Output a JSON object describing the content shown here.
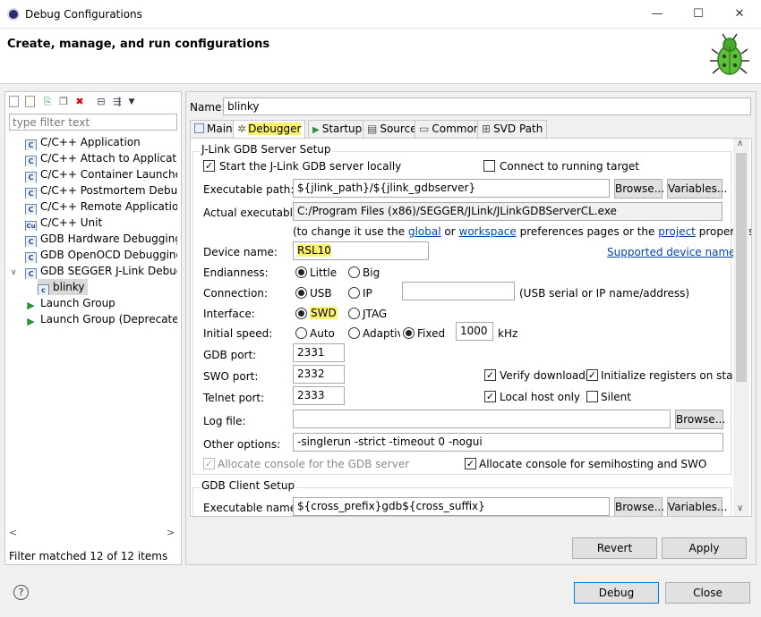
{
  "window": {
    "title": "Debug Configurations",
    "minimize": "—",
    "maximize": "☐",
    "close": "✕"
  },
  "banner": {
    "title": "Create, manage, and run configurations"
  },
  "left": {
    "filter_placeholder": "type filter text",
    "tree": [
      {
        "label": "C/C++ Application",
        "icon": "C"
      },
      {
        "label": "C/C++ Attach to Application",
        "icon": "C"
      },
      {
        "label": "C/C++ Container Launcher",
        "icon": "C"
      },
      {
        "label": "C/C++ Postmortem Debugge",
        "icon": "C"
      },
      {
        "label": "C/C++ Remote Application",
        "icon": "C"
      },
      {
        "label": "C/C++ Unit",
        "icon": "Cu"
      },
      {
        "label": "GDB Hardware Debugging",
        "icon": "C"
      },
      {
        "label": "GDB OpenOCD Debugging",
        "icon": "C"
      },
      {
        "label": "GDB SEGGER J-Link Debuggir",
        "icon": "C"
      },
      {
        "label": "blinky",
        "icon": "c"
      },
      {
        "label": "Launch Group",
        "icon": "play"
      },
      {
        "label": "Launch Group (Deprecated)",
        "icon": "play"
      }
    ],
    "expand_arrow": "∨",
    "scroll_left": "<",
    "scroll_right": ">",
    "status": "Filter matched 12 of 12 items"
  },
  "right": {
    "name_label": "Name:",
    "name_value": "blinky",
    "tabs": [
      "Main",
      "Debugger",
      "Startup",
      "Source",
      "Common",
      "SVD Path"
    ],
    "server": {
      "group_title": "J-Link GDB Server Setup",
      "start_locally": "Start the J-Link GDB server locally",
      "connect_running": "Connect to running target",
      "exe_path_label": "Executable path:",
      "exe_path_value": "${jlink_path}/${jlink_gdbserver}",
      "browse": "Browse...",
      "variables": "Variables...",
      "actual_exe_label": "Actual executable:",
      "actual_exe_value": "C:/Program Files (x86)/SEGGER/JLink/JLinkGDBServerCL.exe",
      "change_note_1": "(to change it use the",
      "link_global": "global",
      "change_note_or": "or",
      "link_workspace": "workspace",
      "change_note_2": "preferences pages or the",
      "link_project": "project",
      "change_note_3": "properties page)",
      "device_label": "Device name:",
      "device_value": "RSL10",
      "supported_devices": "Supported device names",
      "endian_label": "Endianness:",
      "endian_little": "Little",
      "endian_big": "Big",
      "connection_label": "Connection:",
      "conn_usb": "USB",
      "conn_ip": "IP",
      "conn_note": "(USB serial or IP name/address)",
      "interface_label": "Interface:",
      "if_swd": "SWD",
      "if_jtag": "JTAG",
      "speed_label": "Initial speed:",
      "speed_auto": "Auto",
      "speed_adaptive": "Adaptiv",
      "speed_fixed": "Fixed",
      "speed_value": "1000",
      "speed_unit": "kHz",
      "gdb_port_label": "GDB port:",
      "gdb_port": "2331",
      "swo_port_label": "SWO port:",
      "swo_port": "2332",
      "verify_downloads": "Verify downloads",
      "init_registers": "Initialize registers on start",
      "telnet_label": "Telnet port:",
      "telnet_port": "2333",
      "local_host": "Local host only",
      "silent": "Silent",
      "log_label": "Log file:",
      "log_value": "",
      "other_label": "Other options:",
      "other_value": "-singlerun -strict -timeout 0 -nogui",
      "alloc_console_gdb": "Allocate console for the GDB server",
      "alloc_console_semi": "Allocate console for semihosting and SWO"
    },
    "client": {
      "group_title": "GDB Client Setup",
      "exe_label": "Executable name:",
      "exe_value": "${cross_prefix}gdb${cross_suffix}",
      "browse": "Browse...",
      "variables": "Variables..."
    },
    "scroll_up": "∧",
    "scroll_down": "∨",
    "revert": "Revert",
    "apply": "Apply"
  },
  "footer": {
    "help": "?",
    "debug": "Debug",
    "close": "Close"
  }
}
